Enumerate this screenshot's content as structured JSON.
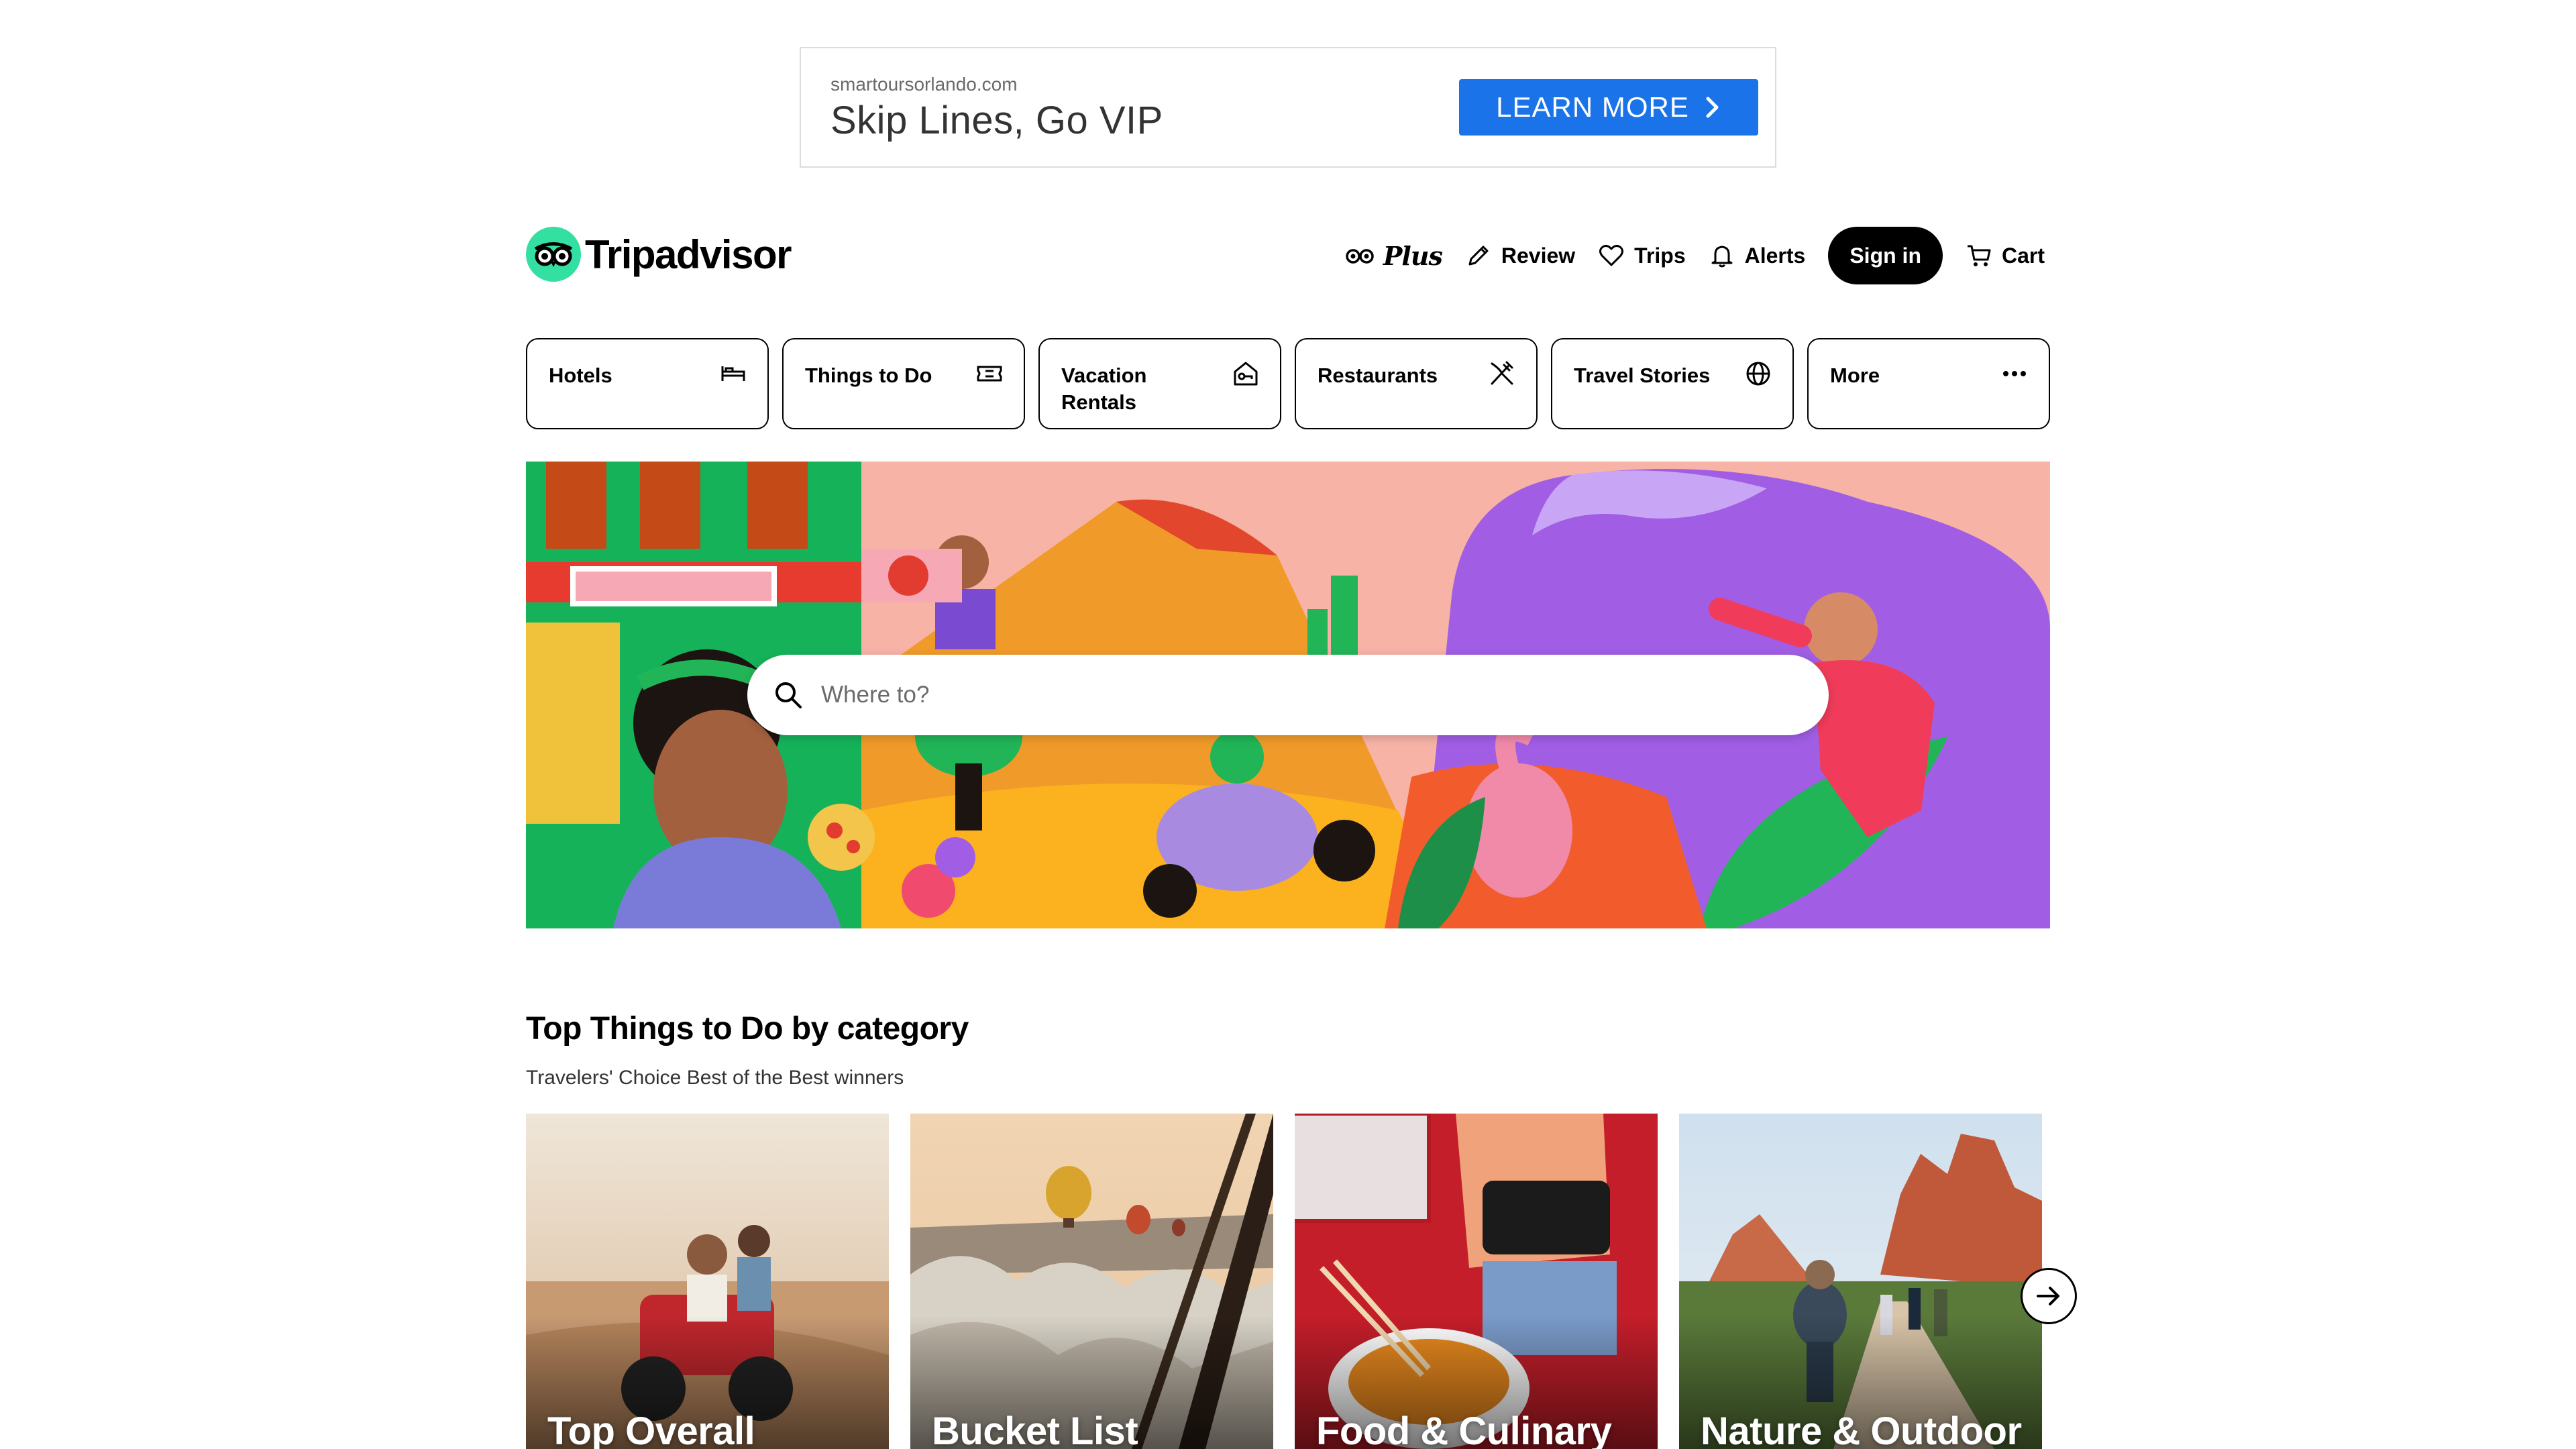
{
  "ad": {
    "domain": "smartoursorlando.com",
    "headline": "Skip Lines, Go VIP",
    "cta_label": "LEARN MORE",
    "cta_color": "#1a73e8"
  },
  "header": {
    "logo_text": "Tripadvisor",
    "brand_color": "#34e0a1",
    "nav": {
      "plus_label": "Plus",
      "review_label": "Review",
      "trips_label": "Trips",
      "alerts_label": "Alerts",
      "signin_label": "Sign in",
      "cart_label": "Cart"
    }
  },
  "categories": [
    {
      "label": "Hotels",
      "icon": "bed-icon"
    },
    {
      "label": "Things to Do",
      "icon": "ticket-icon"
    },
    {
      "label": "Vacation Rentals",
      "icon": "house-key-icon"
    },
    {
      "label": "Restaurants",
      "icon": "fork-knife-icon"
    },
    {
      "label": "Travel Stories",
      "icon": "globe-icon"
    },
    {
      "label": "More",
      "icon": "more-icon"
    }
  ],
  "search": {
    "placeholder": "Where to?"
  },
  "section": {
    "title": "Top Things to Do by category",
    "subtitle": "Travelers' Choice Best of the Best winners",
    "cards": [
      {
        "title": "Top Overall"
      },
      {
        "title": "Bucket List"
      },
      {
        "title": "Food & Culinary"
      },
      {
        "title": "Nature & Outdoor"
      }
    ]
  }
}
